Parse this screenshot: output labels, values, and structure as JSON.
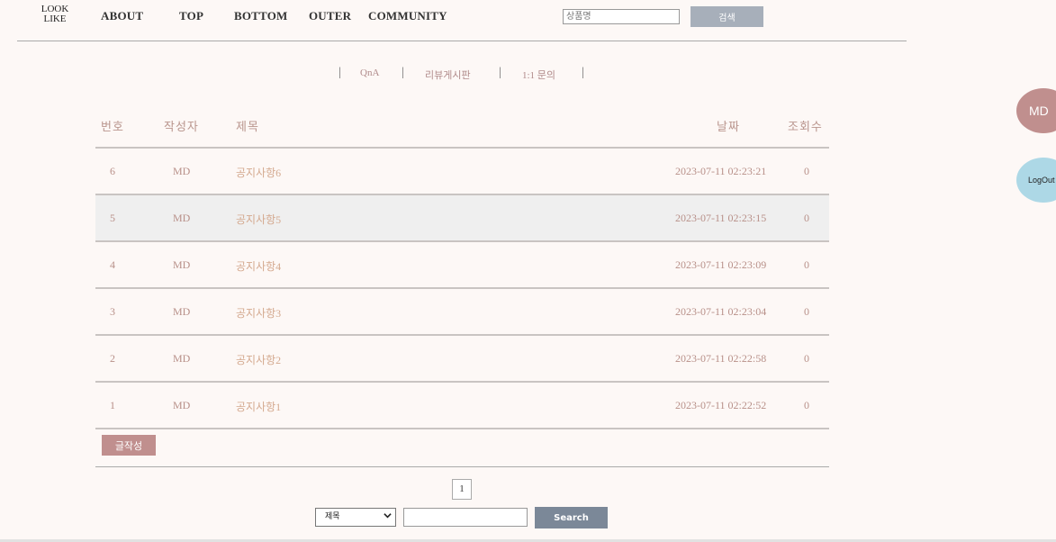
{
  "logo": {
    "line1": "LOOK",
    "line2": "LIKE"
  },
  "nav": [
    "ABOUT",
    "TOP",
    "BOTTOM",
    "OUTER",
    "COMMUNITY"
  ],
  "header_search": {
    "placeholder": "상품명",
    "button": "검색"
  },
  "subnav": [
    "QnA",
    "리뷰게시판",
    "1:1 문의"
  ],
  "table": {
    "headers": {
      "num": "번호",
      "author": "작성자",
      "title": "제목",
      "date": "날짜",
      "views": "조회수"
    },
    "rows": [
      {
        "num": "6",
        "author": "MD",
        "title": "공지사항6",
        "date": "2023-07-11 02:23:21",
        "views": "0"
      },
      {
        "num": "5",
        "author": "MD",
        "title": "공지사항5",
        "date": "2023-07-11 02:23:15",
        "views": "0"
      },
      {
        "num": "4",
        "author": "MD",
        "title": "공지사항4",
        "date": "2023-07-11 02:23:09",
        "views": "0"
      },
      {
        "num": "3",
        "author": "MD",
        "title": "공지사항3",
        "date": "2023-07-11 02:23:04",
        "views": "0"
      },
      {
        "num": "2",
        "author": "MD",
        "title": "공지사항2",
        "date": "2023-07-11 02:22:58",
        "views": "0"
      },
      {
        "num": "1",
        "author": "MD",
        "title": "공지사항1",
        "date": "2023-07-11 02:22:52",
        "views": "0"
      }
    ]
  },
  "write_button": "글작성",
  "pagination": {
    "current": "1"
  },
  "bottom_search": {
    "select_value": "제목",
    "button": "Search"
  },
  "side": {
    "user": "MD",
    "logout": "LogOut"
  },
  "colors": {
    "accent": "#c08f8e",
    "logout_bg": "#add8e6",
    "text_muted": "#b89089"
  }
}
